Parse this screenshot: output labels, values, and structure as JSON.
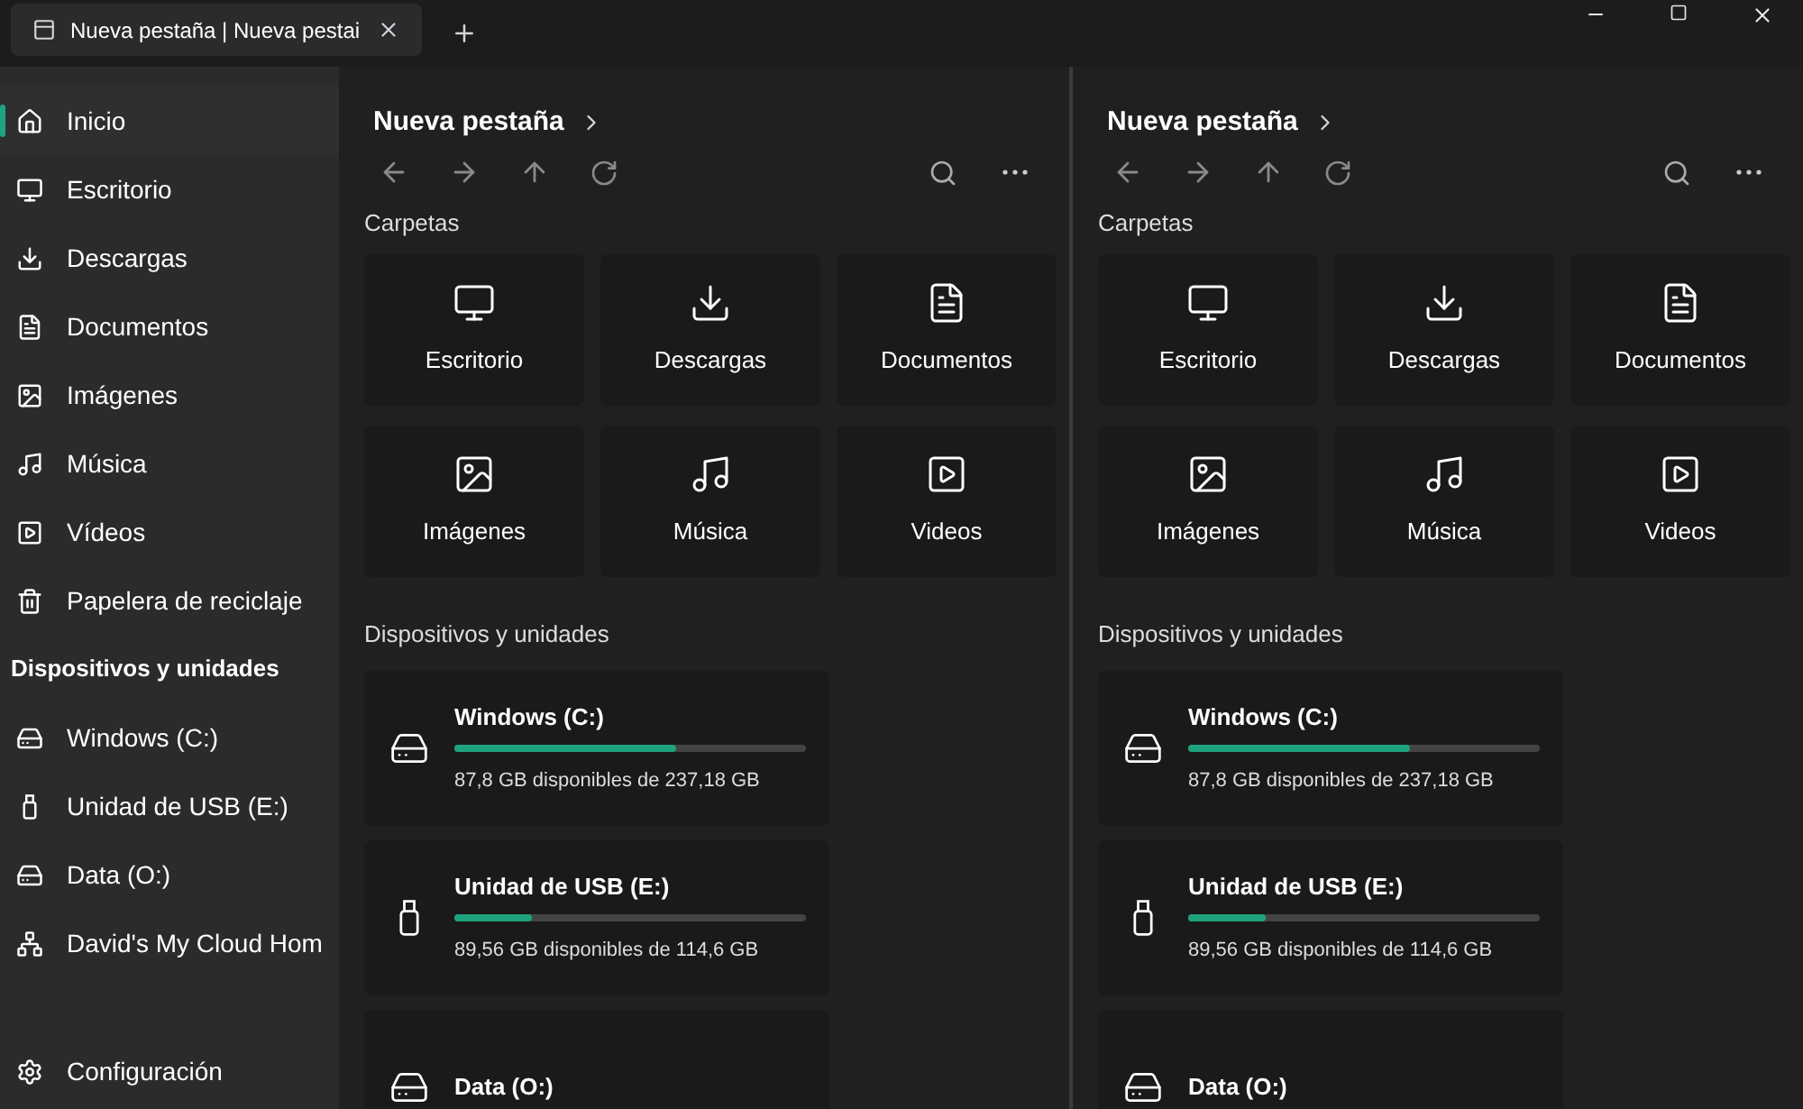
{
  "tab": {
    "title": "Nueva pestaña | Nueva pestai",
    "selected": true
  },
  "sidebar": {
    "items": [
      {
        "label": "Inicio",
        "selected": true
      },
      {
        "label": "Escritorio",
        "selected": false
      },
      {
        "label": "Descargas",
        "selected": false
      },
      {
        "label": "Documentos",
        "selected": false
      },
      {
        "label": "Imágenes",
        "selected": false
      },
      {
        "label": "Música",
        "selected": false
      },
      {
        "label": "Vídeos",
        "selected": false
      },
      {
        "label": "Papelera de reciclaje",
        "selected": false
      }
    ],
    "section_title": "Dispositivos y unidades",
    "devices": [
      {
        "label": "Windows (C:)",
        "kind": "drive",
        "selected": false
      },
      {
        "label": "Unidad de USB (E:)",
        "kind": "usb",
        "selected": false
      },
      {
        "label": "Data (O:)",
        "kind": "drive",
        "selected": false
      },
      {
        "label": "David's My Cloud Hom",
        "kind": "network",
        "selected": false
      }
    ],
    "footer": "Configuración"
  },
  "panes": [
    {
      "title": "Nueva pestaña",
      "folders_title": "Carpetas",
      "folders": [
        "Escritorio",
        "Descargas",
        "Documentos",
        "Imágenes",
        "Música",
        "Videos"
      ],
      "drives_title": "Dispositivos y unidades",
      "drives": [
        {
          "name": "Windows (C:)",
          "kind": "drive",
          "level": 0.63,
          "free": "87,8 GB disponibles de 237,18 GB"
        },
        {
          "name": "Unidad de USB (E:)",
          "kind": "usb",
          "level": 0.22,
          "free": "89,56 GB disponibles de 114,6 GB"
        },
        {
          "name": "Data (O:)",
          "kind": "drive"
        }
      ]
    },
    {
      "title": "Nueva pestaña",
      "folders_title": "Carpetas",
      "folders": [
        "Escritorio",
        "Descargas",
        "Documentos",
        "Imágenes",
        "Música",
        "Videos"
      ],
      "drives_title": "Dispositivos y unidades",
      "drives": [
        {
          "name": "Windows (C:)",
          "kind": "drive",
          "level": 0.63,
          "free": "87,8 GB disponibles de 237,18 GB"
        },
        {
          "name": "Unidad de USB (E:)",
          "kind": "usb",
          "level": 0.22,
          "free": "89,56 GB disponibles de 114,6 GB"
        },
        {
          "name": "Data (O:)",
          "kind": "drive"
        }
      ]
    }
  ]
}
